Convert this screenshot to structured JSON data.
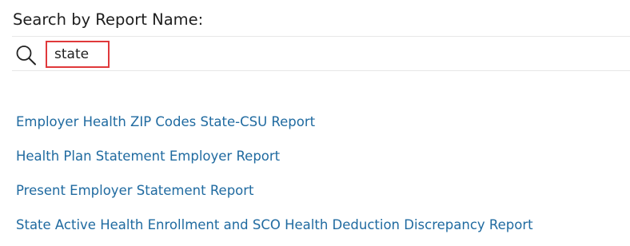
{
  "search": {
    "title": "Search by Report Name:",
    "value": "state",
    "icon": "search-icon",
    "highlight_color": "#e0393b"
  },
  "results": [
    {
      "label": "Employer Health ZIP Codes State-CSU Report"
    },
    {
      "label": "Health Plan Statement Employer Report"
    },
    {
      "label": "Present Employer Statement Report"
    },
    {
      "label": "State Active Health Enrollment and SCO Health Deduction Discrepancy Report"
    }
  ],
  "colors": {
    "link": "#1f6aa0",
    "text": "#1e1e1e",
    "divider": "#e7e7e7"
  }
}
